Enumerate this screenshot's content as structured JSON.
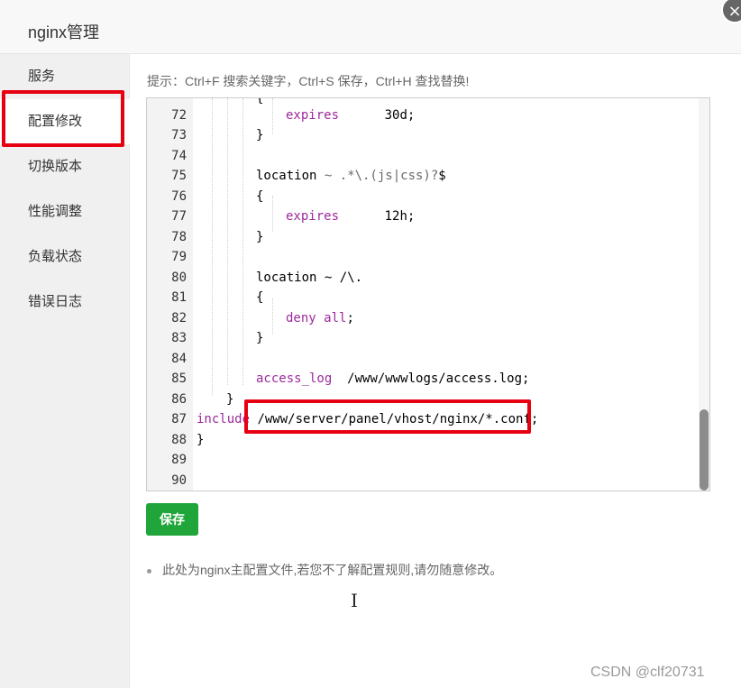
{
  "dialog": {
    "title": "nginx管理",
    "close_icon": "×"
  },
  "sidebar": {
    "items": [
      {
        "label": "服务"
      },
      {
        "label": "配置修改"
      },
      {
        "label": "切换版本"
      },
      {
        "label": "性能调整"
      },
      {
        "label": "负载状态"
      },
      {
        "label": "错误日志"
      }
    ]
  },
  "main": {
    "tip": "提示：Ctrl+F 搜索关键字，Ctrl+S 保存，Ctrl+H 查找替换!",
    "save_label": "保存",
    "note": "此处为nginx主配置文件,若您不了解配置规则,请勿随意修改。"
  },
  "editor": {
    "line_numbers": [
      "72",
      "73",
      "74",
      "75",
      "76",
      "77",
      "78",
      "79",
      "80",
      "81",
      "82",
      "83",
      "84",
      "85",
      "86",
      "87",
      "88",
      "89",
      "90"
    ],
    "lines": {
      "l71": "{",
      "l72_kw": "expires",
      "l72_val": "      30d;",
      "l73": "}",
      "l75_a": "location ",
      "l75_op": "~ .*\\.(js|css)?",
      "l75_b": "$",
      "l76": "{",
      "l77_kw": "expires",
      "l77_val": "      12h;",
      "l78": "}",
      "l80_a": "location ~ /\\.",
      "l81": "{",
      "l82_kw": "deny",
      "l82_val": " all",
      "l82_end": ";",
      "l83": "}",
      "l85_kw": "access_log",
      "l85_val": "  /www/wwwlogs/access.log;",
      "l86": "}",
      "l87_kw": "include",
      "l87_val": " /www/server/panel/vhost/nginx/*.conf;",
      "l88": "}"
    }
  },
  "watermark": "CSDN @clf20731",
  "colors": {
    "accent": "#20a53a",
    "highlight": "#e60012",
    "keyword": "#9d2a9d"
  }
}
